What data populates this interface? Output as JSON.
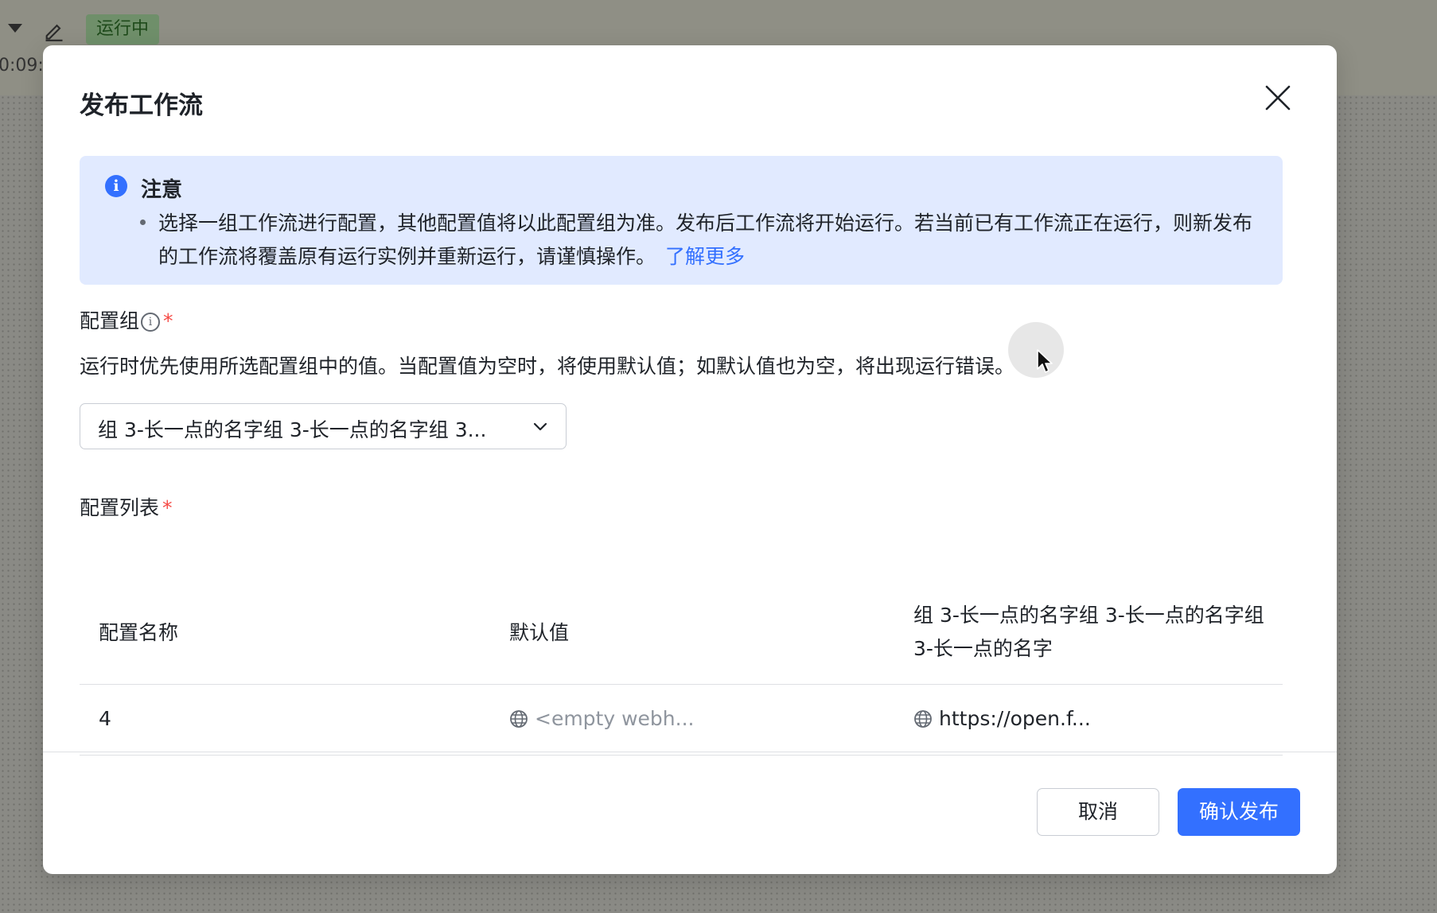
{
  "background": {
    "status_badge": "运行中",
    "time_fragment": "0:09:"
  },
  "dialog": {
    "title": "发布工作流",
    "notice": {
      "title": "注意",
      "text": "选择一组工作流进行配置，其他配置值将以此配置组为准。发布后工作流将开始运行。若当前已有工作流正在运行，则新发布的工作流将覆盖原有运行实例并重新运行，请谨慎操作。",
      "link": "了解更多"
    },
    "config_group": {
      "label": "配置组",
      "required_mark": "*",
      "description": "运行时优先使用所选配置组中的值。当配置值为空时，将使用默认值；如默认值也为空，将出现运行错误。",
      "selected_value": "组 3-长一点的名字组 3-长一点的名字组 3..."
    },
    "config_list": {
      "label": "配置列表",
      "required_mark": "*",
      "columns": [
        "配置名称",
        "默认值",
        "组 3-长一点的名字组 3-长一点的名字组 3-长一点的名字"
      ],
      "rows": [
        {
          "name": "4",
          "default": "<empty webh...",
          "group_value": "https://open.f..."
        }
      ]
    },
    "buttons": {
      "cancel": "取消",
      "confirm": "确认发布"
    }
  },
  "colors": {
    "primary": "#3370ff",
    "notice_bg": "#e1eaff",
    "required": "#f54a45"
  }
}
